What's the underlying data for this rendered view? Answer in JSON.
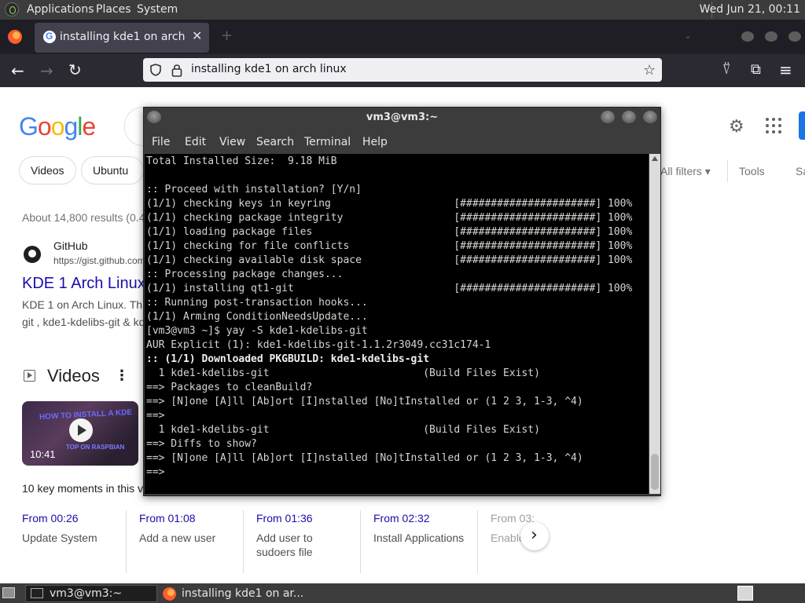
{
  "top_panel": {
    "menus": [
      "Applications",
      "Places",
      "System"
    ],
    "clock": "Wed Jun 21, 00:11"
  },
  "browser": {
    "tab": {
      "title": "installing kde1 on arch linux",
      "close": "✕"
    },
    "new_tab": "+",
    "url": "installing kde1 on arch linux",
    "nav": {
      "back": "←",
      "forward": "→",
      "reload": "↻",
      "star": "☆",
      "pocket": "⍢",
      "extensions": "⧉",
      "menu": "≡"
    }
  },
  "google": {
    "logo_letters": [
      {
        "ch": "G",
        "color": "#4285f4"
      },
      {
        "ch": "o",
        "color": "#ea4335"
      },
      {
        "ch": "o",
        "color": "#fbbc05"
      },
      {
        "ch": "g",
        "color": "#4285f4"
      },
      {
        "ch": "l",
        "color": "#34a853"
      },
      {
        "ch": "e",
        "color": "#ea4335"
      }
    ],
    "chips": [
      "Videos",
      "Ubuntu"
    ],
    "all_filters": "All filters ▾",
    "tools": "Tools",
    "sa": "Sa",
    "results_stats": "About 14,800 results (0.4",
    "result": {
      "site": "GitHub",
      "url": "https://gist.github.com",
      "title": "KDE 1 Arch Linux",
      "snippet1": "KDE 1 on Arch Linux. Th",
      "snippet2": "git , kde1-kdelibs-git & kd"
    },
    "videos_heading": "Videos",
    "video": {
      "duration": "10:41",
      "thumb_line1": "HOW TO INSTALL A KDE",
      "thumb_line2": "TOP ON RASPBIAN"
    },
    "key_moments": "10 key moments in this v",
    "moments": [
      {
        "time": "From 00:26",
        "label": "Update System"
      },
      {
        "time": "From 01:08",
        "label": "Add a new user"
      },
      {
        "time": "From 01:36",
        "label": "Add user to sudoers file"
      },
      {
        "time": "From 02:32",
        "label": "Install Applications"
      },
      {
        "time": "From 03:",
        "label": "Enable"
      }
    ]
  },
  "terminal": {
    "title": "vm3@vm3:~",
    "menus": [
      "File",
      "Edit",
      "View",
      "Search",
      "Terminal",
      "Help"
    ],
    "lines": [
      {
        "text": "Total Installed Size:  9.18 MiB",
        "bold": false
      },
      {
        "text": "",
        "bold": false
      },
      {
        "text": ":: Proceed with installation? [Y/n]",
        "bold": false
      },
      {
        "text": "(1/1) checking keys in keyring                    [######################] 100%",
        "bold": false
      },
      {
        "text": "(1/1) checking package integrity                  [######################] 100%",
        "bold": false
      },
      {
        "text": "(1/1) loading package files                       [######################] 100%",
        "bold": false
      },
      {
        "text": "(1/1) checking for file conflicts                 [######################] 100%",
        "bold": false
      },
      {
        "text": "(1/1) checking available disk space               [######################] 100%",
        "bold": false
      },
      {
        "text": ":: Processing package changes...",
        "bold": false
      },
      {
        "text": "(1/1) installing qt1-git                          [######################] 100%",
        "bold": false
      },
      {
        "text": ":: Running post-transaction hooks...",
        "bold": false
      },
      {
        "text": "(1/1) Arming ConditionNeedsUpdate...",
        "bold": false
      },
      {
        "text": "[vm3@vm3 ~]$ yay -S kde1-kdelibs-git",
        "bold": false
      },
      {
        "text": "AUR Explicit (1): kde1-kdelibs-git-1.1.2r3049.cc31c174-1",
        "bold": false
      },
      {
        "text": ":: (1/1) Downloaded PKGBUILD: kde1-kdelibs-git",
        "bold": true
      },
      {
        "text": "  1 kde1-kdelibs-git                         (Build Files Exist)",
        "bold": false
      },
      {
        "text": "==> Packages to cleanBuild?",
        "bold": false
      },
      {
        "text": "==> [N]one [A]ll [Ab]ort [I]nstalled [No]tInstalled or (1 2 3, 1-3, ^4)",
        "bold": false
      },
      {
        "text": "==>",
        "bold": false
      },
      {
        "text": "  1 kde1-kdelibs-git                         (Build Files Exist)",
        "bold": false
      },
      {
        "text": "==> Diffs to show?",
        "bold": false
      },
      {
        "text": "==> [N]one [A]ll [Ab]ort [I]nstalled [No]tInstalled or (1 2 3, 1-3, ^4)",
        "bold": false
      },
      {
        "text": "==>",
        "bold": false
      }
    ]
  },
  "taskbar": {
    "items": [
      "vm3@vm3:~",
      "installing kde1 on ar..."
    ]
  }
}
